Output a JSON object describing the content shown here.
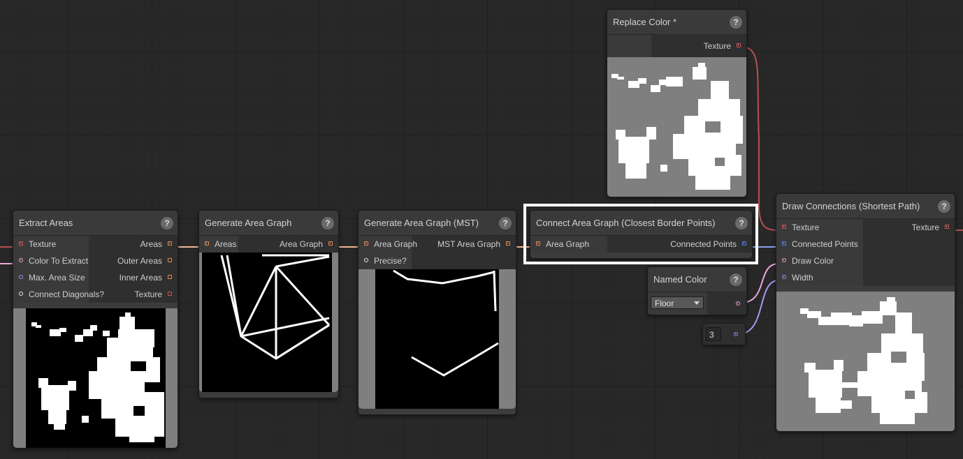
{
  "nodes": {
    "extract_areas": {
      "title": "Extract Areas",
      "inputs": [
        "Texture",
        "Color To Extract",
        "Max. Area Size",
        "Connect Diagonals?"
      ],
      "outputs": [
        "Areas",
        "Outer Areas",
        "Inner Areas",
        "Texture"
      ]
    },
    "generate_area_graph": {
      "title": "Generate Area Graph",
      "inputs": [
        "Areas"
      ],
      "outputs": [
        "Area Graph"
      ]
    },
    "generate_area_graph_mst": {
      "title": "Generate Area Graph (MST)",
      "inputs": [
        "Area Graph",
        "Precise?"
      ],
      "outputs": [
        "MST Area Graph"
      ]
    },
    "connect_area_graph": {
      "title": "Connect Area Graph (Closest Border Points)",
      "inputs": [
        "Area Graph"
      ],
      "outputs": [
        "Connected Points"
      ]
    },
    "replace_color": {
      "title": "Replace Color *",
      "outputs": [
        "Texture"
      ]
    },
    "named_color": {
      "title": "Named Color",
      "selected": "Floor"
    },
    "width_value": {
      "value": "3"
    },
    "draw_connections": {
      "title": "Draw Connections (Shortest Path)",
      "inputs": [
        "Texture",
        "Connected Points",
        "Draw Color",
        "Width"
      ],
      "outputs": [
        "Texture"
      ]
    }
  },
  "help_label": "?",
  "colors": {
    "texture_port": "#e05050",
    "area_port": "#f08850",
    "color_port": "#f0a0d8",
    "int_port": "#9a8cf0",
    "bool_port": "#e8e8e8",
    "points_port": "#5080f0",
    "wire_texture": "#b85050",
    "wire_area": "#f0b898",
    "wire_points": "#8da0f0",
    "wire_color": "#e8a8e0",
    "wire_int": "#a898f0",
    "selection": "#ffffff"
  }
}
